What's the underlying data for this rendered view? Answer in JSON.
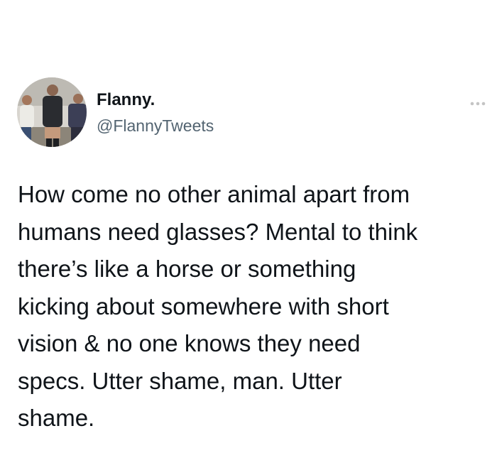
{
  "tweet": {
    "author": {
      "display_name": "Flanny.",
      "handle": "@FlannyTweets"
    },
    "more_icon": "more-horizontal-icon",
    "text": "How come no other animal apart from\nhumans need glasses? Mental to think\nthere’s like a horse or something\nkicking about somewhere with short\nvision & no one knows they need\nspecs. Utter shame, man. Utter\nshame."
  },
  "colors": {
    "background": "#ffffff",
    "text_primary": "#0f1419",
    "text_secondary": "#536471",
    "more_icon": "#c4c4c4"
  }
}
